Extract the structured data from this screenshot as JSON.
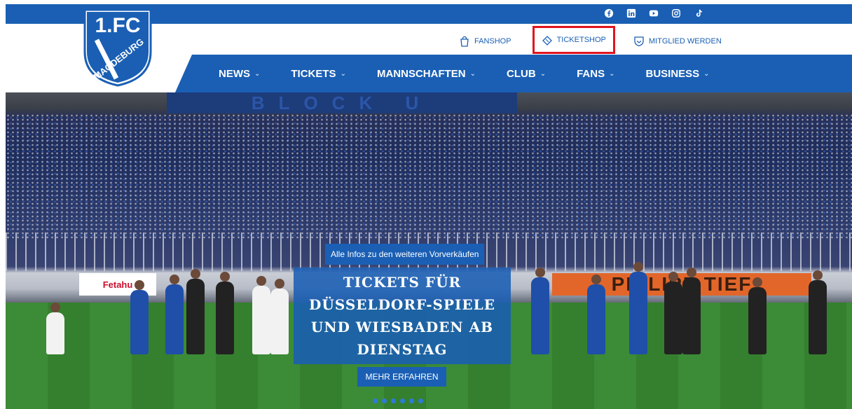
{
  "brand": {
    "logo_top": "1.FC",
    "logo_bottom": "MAGDEBURG",
    "primary_color": "#1a5fb4",
    "highlight_color": "#e0141e"
  },
  "social": [
    {
      "icon": "facebook-icon"
    },
    {
      "icon": "linkedin-icon"
    },
    {
      "icon": "youtube-icon"
    },
    {
      "icon": "instagram-icon"
    },
    {
      "icon": "tiktok-icon"
    }
  ],
  "top_links": {
    "fanshop": "FANSHOP",
    "ticketshop": "TICKETSHOP",
    "member": "MITGLIED WERDEN"
  },
  "nav": [
    {
      "label": "NEWS"
    },
    {
      "label": "TICKETS"
    },
    {
      "label": "MANNSCHAFTEN"
    },
    {
      "label": "CLUB"
    },
    {
      "label": "FANS"
    },
    {
      "label": "BUSINESS"
    }
  ],
  "nav_chevron": "⌄",
  "hero": {
    "roof_banner": "BLOCK U",
    "ad_left": "Fetahu",
    "ad_right": "PHILIPP TIEF",
    "tag": "Alle Infos zu den weiteren Vorverkäufen",
    "title_line1": "TICKETS FÜR",
    "title_line2": "DÜSSELDORF-SPIELE",
    "title_line3": "UND WIESBADEN AB",
    "title_line4": "DIENSTAG",
    "cta": "MEHR ERFAHREN",
    "slides": 6
  }
}
